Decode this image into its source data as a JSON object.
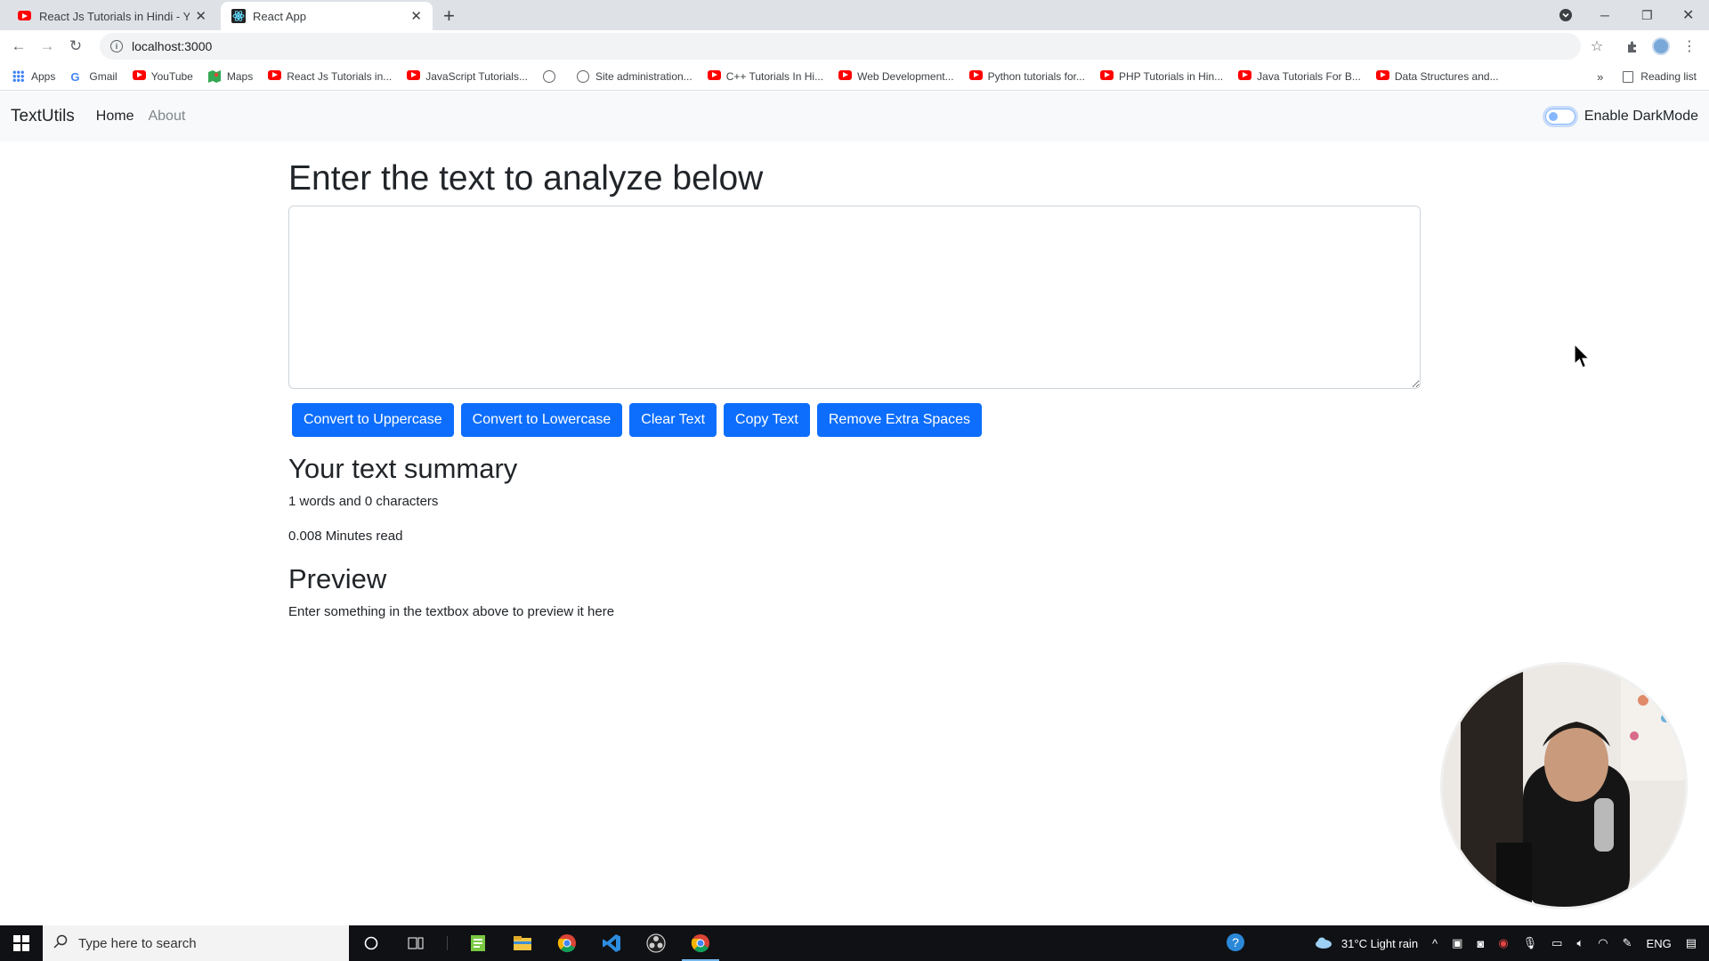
{
  "browser": {
    "tabs": [
      {
        "title": "React Js Tutorials in Hindi - YouT",
        "icon": "youtube-icon"
      },
      {
        "title": "React App",
        "icon": "react-icon"
      }
    ],
    "url": "localhost:3000",
    "bookmarks": [
      {
        "label": "Apps",
        "icon": "apps-grid-icon"
      },
      {
        "label": "Gmail",
        "icon": "google-icon"
      },
      {
        "label": "YouTube",
        "icon": "youtube-icon"
      },
      {
        "label": "Maps",
        "icon": "maps-icon"
      },
      {
        "label": "React Js Tutorials in...",
        "icon": "youtube-icon"
      },
      {
        "label": "JavaScript Tutorials...",
        "icon": "youtube-icon"
      },
      {
        "label": "",
        "icon": "globe-icon"
      },
      {
        "label": "Site administration...",
        "icon": "globe-icon"
      },
      {
        "label": "C++ Tutorials In Hi...",
        "icon": "youtube-icon"
      },
      {
        "label": "Web Development...",
        "icon": "youtube-icon"
      },
      {
        "label": "Python tutorials for...",
        "icon": "youtube-icon"
      },
      {
        "label": "PHP Tutorials in Hin...",
        "icon": "youtube-icon"
      },
      {
        "label": "Java Tutorials For B...",
        "icon": "youtube-icon"
      },
      {
        "label": "Data Structures and...",
        "icon": "youtube-icon"
      }
    ],
    "reading_list": "Reading list"
  },
  "app": {
    "brand": "TextUtils",
    "nav": {
      "home": "Home",
      "about": "About"
    },
    "darkmode_label": "Enable DarkMode",
    "heading": "Enter the text to analyze below",
    "textarea_value": "",
    "buttons": {
      "uppercase": "Convert to Uppercase",
      "lowercase": "Convert to Lowercase",
      "clear": "Clear Text",
      "copy": "Copy Text",
      "spaces": "Remove Extra Spaces"
    },
    "summary_heading": "Your text summary",
    "summary_counts": "1 words and 0 characters",
    "summary_read": "0.008 Minutes read",
    "preview_heading": "Preview",
    "preview_text": "Enter something in the textbox above to preview it here"
  },
  "taskbar": {
    "search_placeholder": "Type here to search",
    "weather": "31°C  Light rain",
    "language": "ENG"
  },
  "colors": {
    "primary": "#0d6efd",
    "navbar_bg": "#f8f9fa",
    "text": "#212529"
  }
}
